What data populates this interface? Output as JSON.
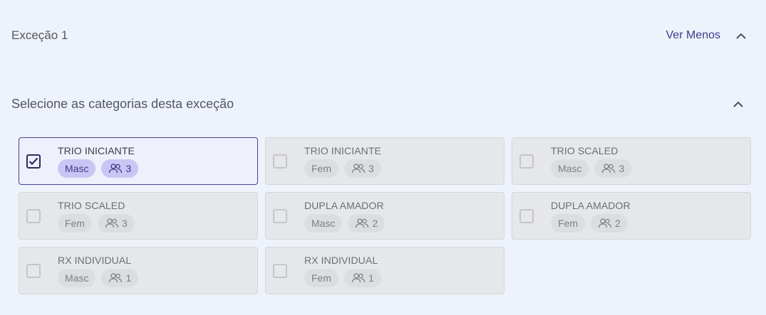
{
  "header": {
    "title": "Exceção 1",
    "toggle_label": "Ver Menos"
  },
  "section": {
    "title": "Selecione as categorias desta exceção"
  },
  "categories": [
    {
      "title": "TRIO INICIANTE",
      "gender": "Masc",
      "count": "3",
      "checked": true
    },
    {
      "title": "TRIO INICIANTE",
      "gender": "Fem",
      "count": "3",
      "checked": false
    },
    {
      "title": "TRIO SCALED",
      "gender": "Masc",
      "count": "3",
      "checked": false
    },
    {
      "title": "TRIO SCALED",
      "gender": "Fem",
      "count": "3",
      "checked": false
    },
    {
      "title": "DUPLA AMADOR",
      "gender": "Masc",
      "count": "2",
      "checked": false
    },
    {
      "title": "DUPLA AMADOR",
      "gender": "Fem",
      "count": "2",
      "checked": false
    },
    {
      "title": "RX INDIVIDUAL",
      "gender": "Masc",
      "count": "1",
      "checked": false
    },
    {
      "title": "RX INDIVIDUAL",
      "gender": "Fem",
      "count": "1",
      "checked": false
    }
  ],
  "icons": {
    "header_toggle": "chevron-up-icon",
    "section_toggle": "chevron-up-icon",
    "team_size": "users-icon",
    "check": "check-icon"
  },
  "colors": {
    "accent": "#3d3a8c",
    "selected_chip": "#c9c6f5",
    "background": "#eef2fa"
  }
}
